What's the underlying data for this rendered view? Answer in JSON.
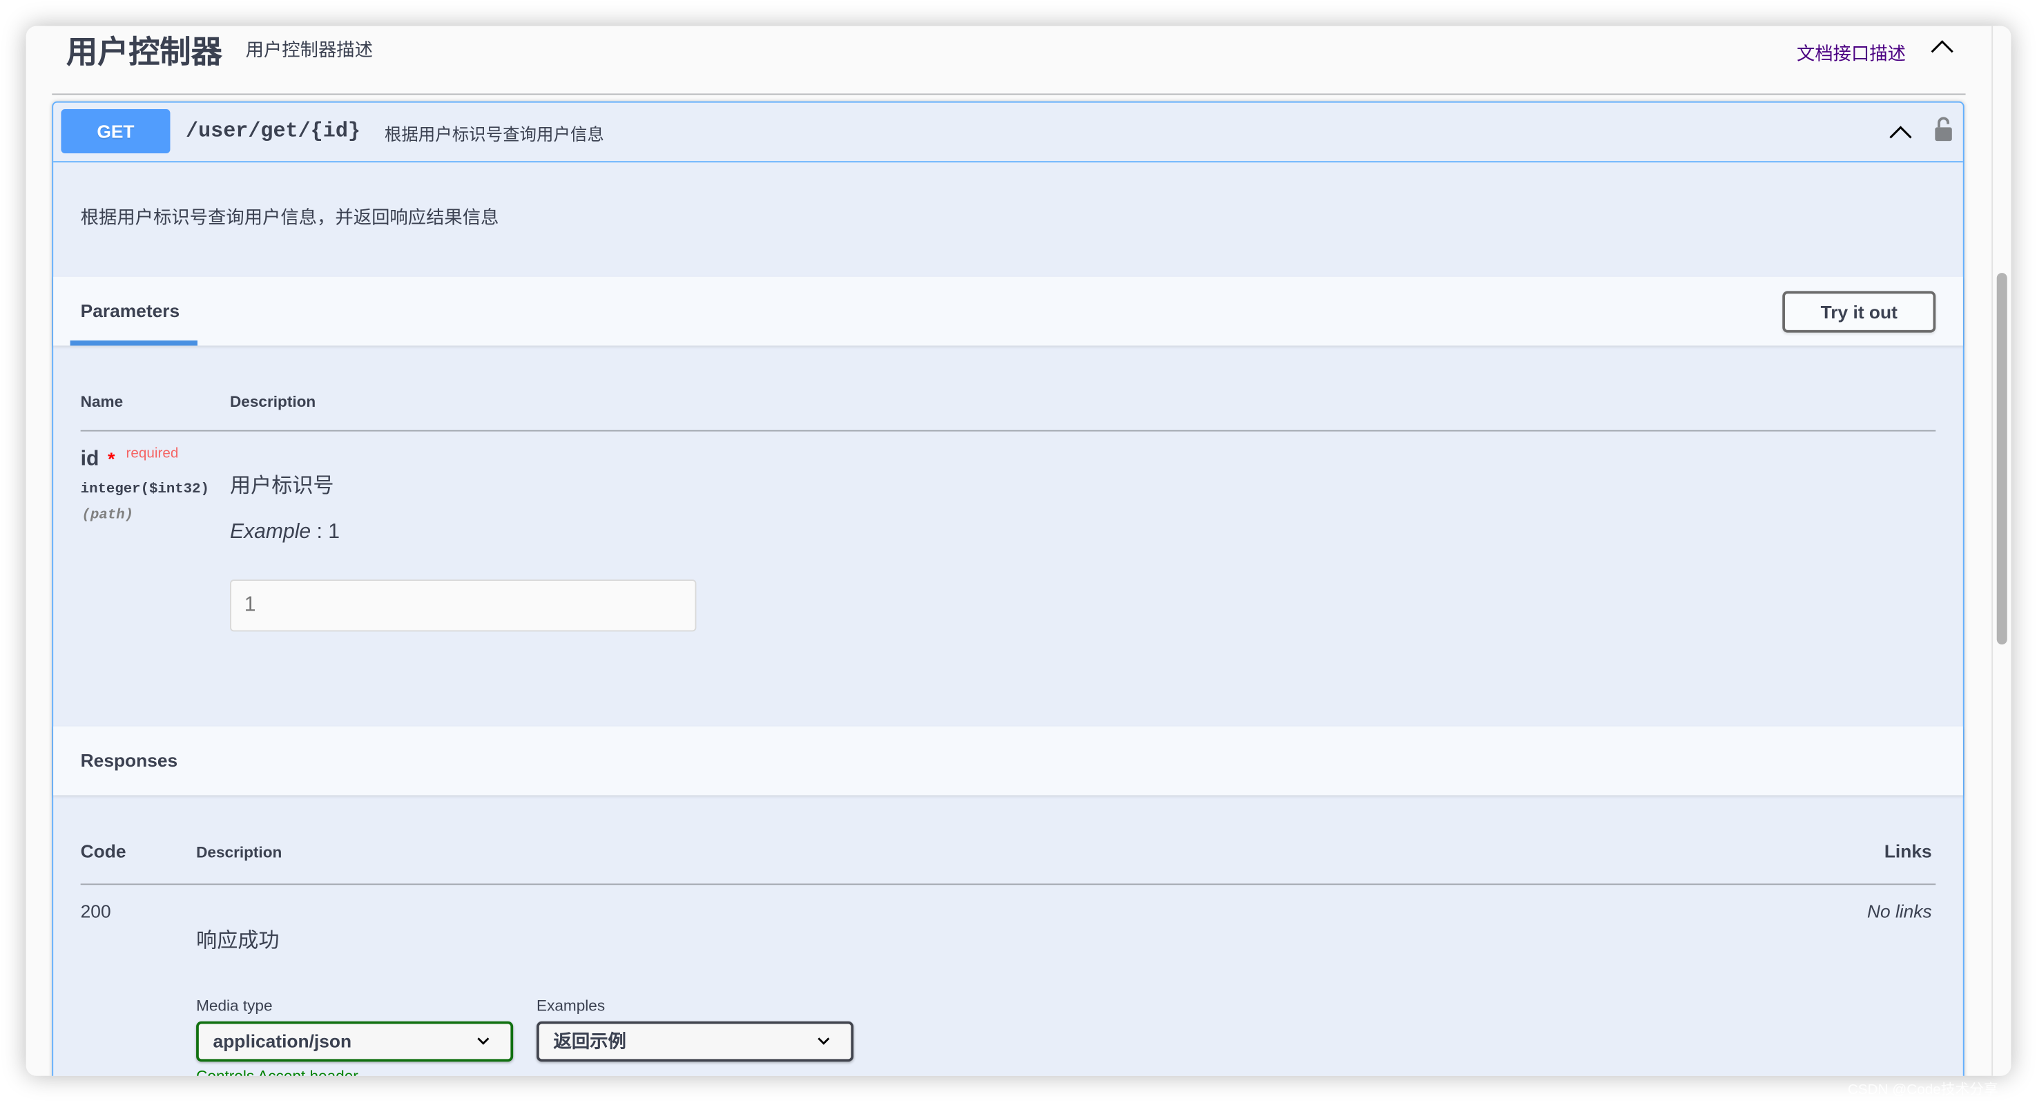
{
  "tag": {
    "title": "用户控制器",
    "description": "用户控制器描述",
    "doc_link": "文档接口描述",
    "expanded": true
  },
  "operation": {
    "method": "GET",
    "path": "/user/get/{id}",
    "summary": "根据用户标识号查询用户信息",
    "description": "根据用户标识号查询用户信息，并返回响应结果信息",
    "lock_state": "unlocked"
  },
  "parameters": {
    "section_title": "Parameters",
    "try_button": "Try it out",
    "columns": [
      "Name",
      "Description"
    ],
    "items": [
      {
        "name": "id",
        "required_star": "*",
        "required_label": "required",
        "type": "integer($int32)",
        "in": "(path)",
        "description": "用户标识号",
        "example_label": "Example",
        "example_value": " : 1",
        "input_placeholder": "1"
      }
    ]
  },
  "responses": {
    "section_title": "Responses",
    "columns": [
      "Code",
      "Description",
      "Links"
    ],
    "items": [
      {
        "code": "200",
        "description": "响应成功",
        "links": "No links",
        "media_type_label": "Media type",
        "media_type_value": "application/json",
        "examples_label": "Examples",
        "examples_value": "返回示例",
        "controls_text": "Controls Accept header."
      }
    ]
  },
  "colors": {
    "get_method": "#519dfd",
    "opblock_border": "#61affe",
    "opblock_bg": "#e8eef9",
    "doc_link": "#4b0082",
    "required": "#f56565",
    "media_type_border": "#107010"
  },
  "watermark": "CSDN @Code技术分享"
}
